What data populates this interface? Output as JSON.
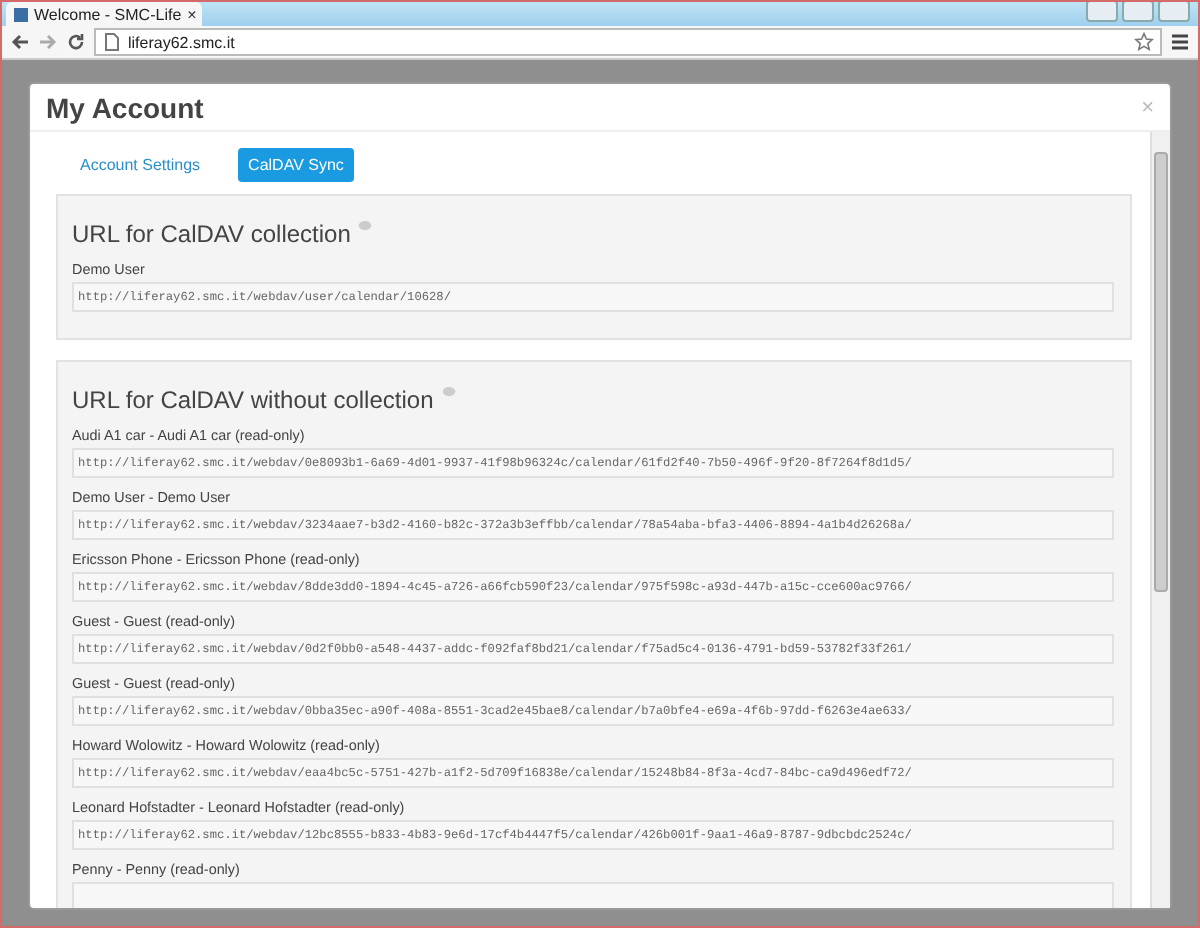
{
  "browser": {
    "tab_title": "Welcome - SMC-Life",
    "tab_close": "×",
    "url": "liferay62.smc.it"
  },
  "dialog": {
    "title": "My Account",
    "close": "×",
    "tabs": [
      {
        "label": "Account Settings",
        "selected": false
      },
      {
        "label": "CalDAV Sync",
        "selected": true
      }
    ],
    "sections": [
      {
        "title": "URL for CalDAV collection",
        "entries": [
          {
            "label": "Demo User",
            "url": "http://liferay62.smc.it/webdav/user/calendar/10628/"
          }
        ]
      },
      {
        "title": "URL for CalDAV without collection",
        "entries": [
          {
            "label": "Audi A1 car - Audi A1 car (read-only)",
            "url": "http://liferay62.smc.it/webdav/0e8093b1-6a69-4d01-9937-41f98b96324c/calendar/61fd2f40-7b50-496f-9f20-8f7264f8d1d5/"
          },
          {
            "label": "Demo User - Demo User",
            "url": "http://liferay62.smc.it/webdav/3234aae7-b3d2-4160-b82c-372a3b3effbb/calendar/78a54aba-bfa3-4406-8894-4a1b4d26268a/"
          },
          {
            "label": "Ericsson Phone - Ericsson Phone (read-only)",
            "url": "http://liferay62.smc.it/webdav/8dde3dd0-1894-4c45-a726-a66fcb590f23/calendar/975f598c-a93d-447b-a15c-cce600ac9766/"
          },
          {
            "label": "Guest - Guest (read-only)",
            "url": "http://liferay62.smc.it/webdav/0d2f0bb0-a548-4437-addc-f092faf8bd21/calendar/f75ad5c4-0136-4791-bd59-53782f33f261/"
          },
          {
            "label": "Guest - Guest (read-only)",
            "url": "http://liferay62.smc.it/webdav/0bba35ec-a90f-408a-8551-3cad2e45bae8/calendar/b7a0bfe4-e69a-4f6b-97dd-f6263e4ae633/"
          },
          {
            "label": "Howard Wolowitz - Howard Wolowitz (read-only)",
            "url": "http://liferay62.smc.it/webdav/eaa4bc5c-5751-427b-a1f2-5d709f16838e/calendar/15248b84-8f3a-4cd7-84bc-ca9d496edf72/"
          },
          {
            "label": "Leonard Hofstadter - Leonard Hofstadter (read-only)",
            "url": "http://liferay62.smc.it/webdav/12bc8555-b833-4b83-9e6d-17cf4b4447f5/calendar/426b001f-9aa1-46a9-8787-9dbcbdc2524c/"
          },
          {
            "label": "Penny - Penny (read-only)"
          }
        ]
      }
    ]
  }
}
